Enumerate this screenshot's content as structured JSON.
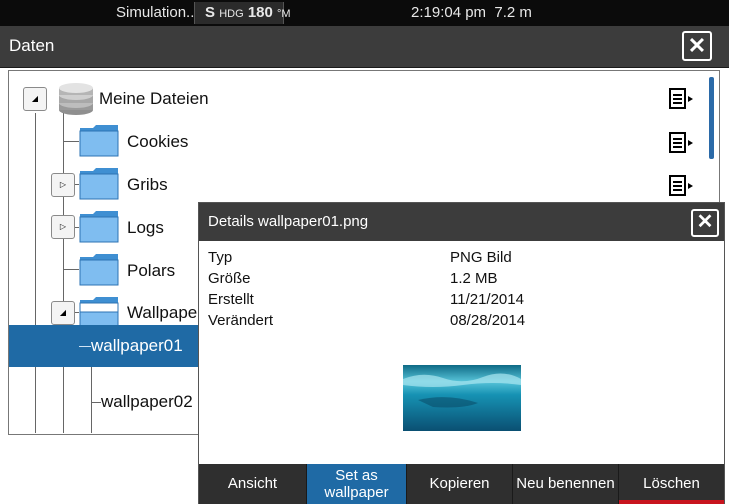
{
  "status_bar": {
    "simulation": "Simulation...",
    "hdg_prefix": "S",
    "hdg_label": "HDG",
    "hdg_value": "180",
    "hdg_unit": "°M",
    "time": "2:19:04 pm",
    "depth": "7.2 m"
  },
  "window": {
    "title": "Daten",
    "close": "✕"
  },
  "tree": {
    "root": {
      "label": "Meine Dateien",
      "expanded": true
    },
    "items": [
      {
        "label": "Cookies"
      },
      {
        "label": "Gribs"
      },
      {
        "label": "Logs"
      },
      {
        "label": "Polars"
      },
      {
        "label": "Wallpape"
      }
    ],
    "files": [
      {
        "label": "wallpaper01",
        "selected": true
      },
      {
        "label": "wallpaper02",
        "selected": false
      }
    ],
    "toggle_collapsed": "▷",
    "toggle_expanded": "◢"
  },
  "details": {
    "title": "Details wallpaper01.png",
    "close": "✕",
    "properties": [
      {
        "name": "Typ",
        "value": "PNG Bild"
      },
      {
        "name": "Größe",
        "value": "1.2 MB"
      },
      {
        "name": "Erstellt",
        "value": "11/21/2014"
      },
      {
        "name": "Verändert",
        "value": "08/28/2014"
      }
    ],
    "buttons": {
      "view": "Ansicht",
      "set_wallpaper_1": "Set as",
      "set_wallpaper_2": "wallpaper",
      "copy": "Kopieren",
      "rename": "Neu benennen",
      "delete": "Löschen"
    }
  },
  "colors": {
    "selection": "#1f6aa5",
    "header": "#3c3c3c",
    "delete_accent": "#c8141e"
  }
}
